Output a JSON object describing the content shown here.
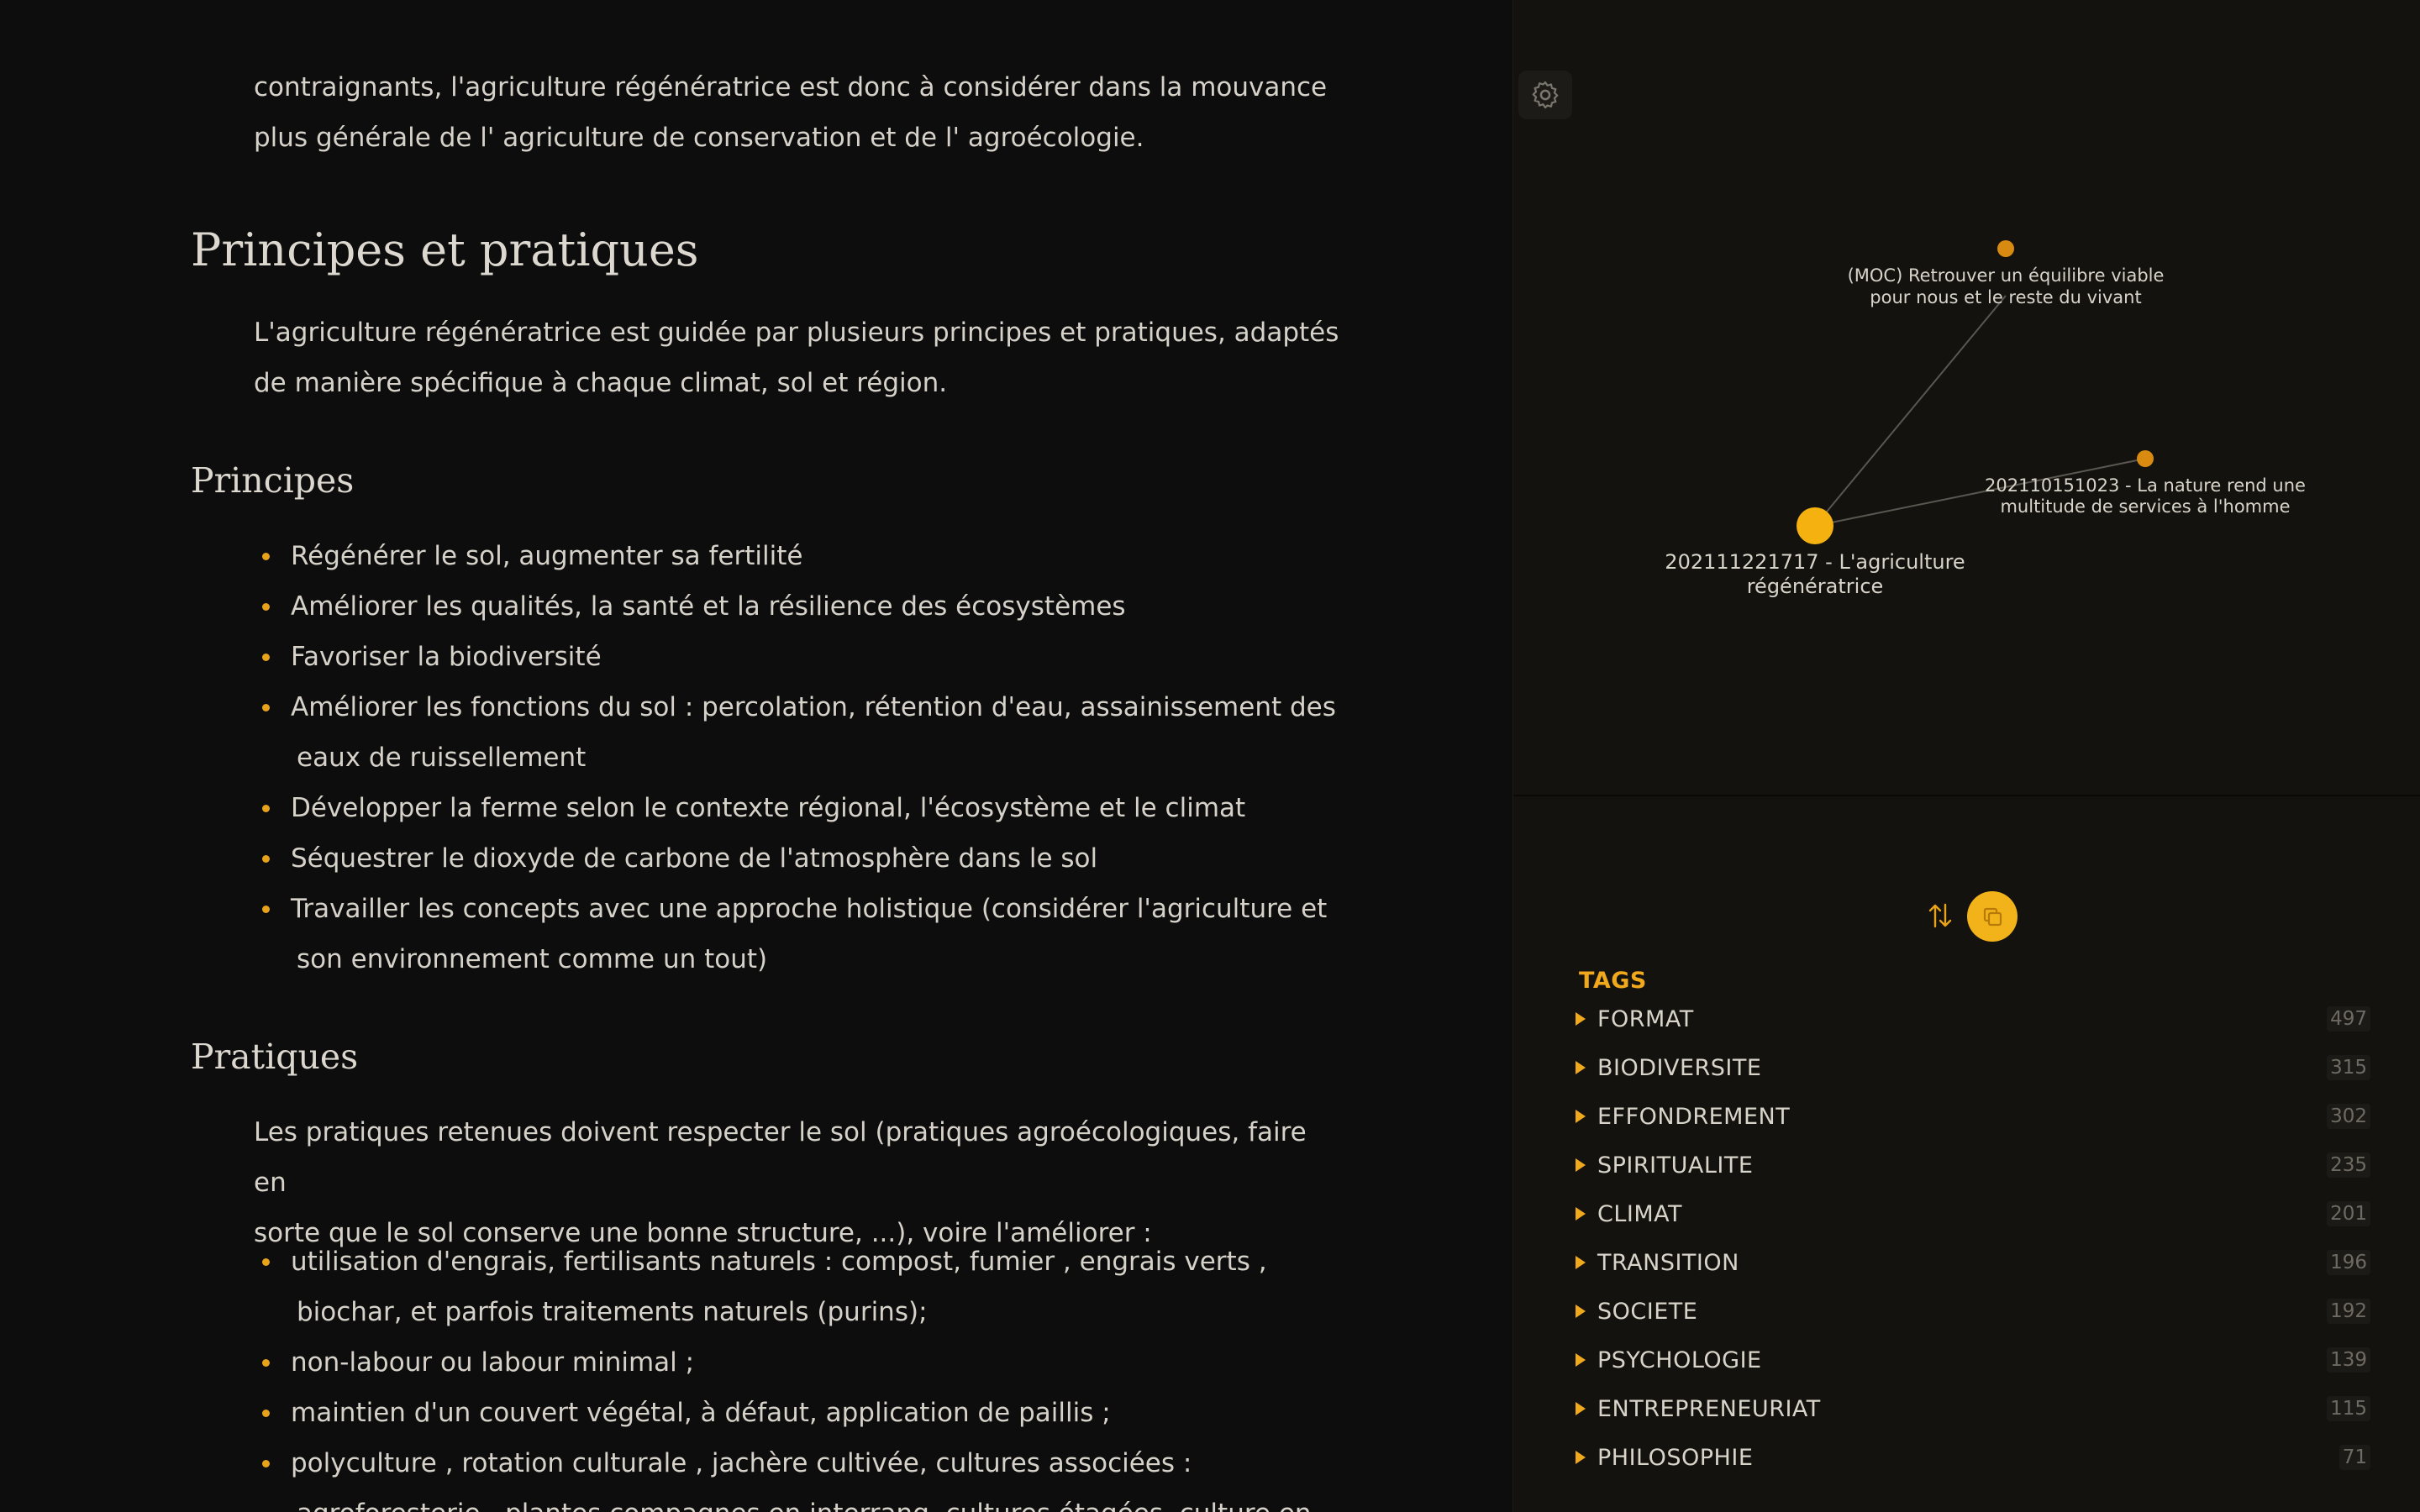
{
  "document": {
    "intro_lines": [
      "contraignants, l'agriculture régénératrice est donc à considérer dans la mouvance",
      "plus générale de l' agriculture de conservation et de l' agroécologie."
    ],
    "h1": "Principes et pratiques",
    "h1_para_lines": [
      "L'agriculture régénératrice est guidée par plusieurs principes et pratiques, adaptés",
      "de manière spécifique à chaque climat, sol et région."
    ],
    "principes": {
      "heading": "Principes",
      "items": [
        {
          "line1": "Régénérer le sol, augmenter sa fertilité",
          "line2": ""
        },
        {
          "line1": "Améliorer les qualités, la santé et la résilience des écosystèmes",
          "line2": ""
        },
        {
          "line1": "Favoriser la biodiversité",
          "line2": ""
        },
        {
          "line1": "Améliorer les fonctions du sol : percolation, rétention d'eau, assainissement des",
          "line2": "eaux de ruissellement"
        },
        {
          "line1": "Développer la ferme selon le contexte régional, l'écosystème et le climat",
          "line2": ""
        },
        {
          "line1": "Séquestrer le dioxyde de carbone de l'atmosphère dans le sol",
          "line2": ""
        },
        {
          "line1": "Travailler les concepts avec une approche holistique (considérer l'agriculture et",
          "line2": "son environnement comme un tout)"
        }
      ]
    },
    "pratiques": {
      "heading": "Pratiques",
      "para_lines": [
        "Les pratiques retenues doivent respecter le sol (pratiques agroécologiques, faire en",
        "sorte que le sol conserve une bonne structure, ...), voire l'améliorer :"
      ],
      "items": [
        {
          "line1": "utilisation d'engrais, fertilisants naturels : compost, fumier , engrais verts ,",
          "line2": "biochar, et parfois traitements naturels (purins);"
        },
        {
          "line1": "non-labour ou labour minimal ;",
          "line2": ""
        },
        {
          "line1": "maintien d'un couvert végétal, à défaut, application de paillis ;",
          "line2": ""
        },
        {
          "line1": "polyculture , rotation culturale , jachère cultivée, cultures associées :",
          "line2": "agroforesterie , plantes compagnes en interrang, cultures étagées, culture en"
        }
      ]
    }
  },
  "graph": {
    "settings_icon": "gear-icon",
    "nodes": {
      "current": {
        "label_line1": "202111221717 - L'agriculture",
        "label_line2": "régénératrice"
      },
      "moc": {
        "label_line1": "(MOC) Retrouver un équilibre viable",
        "label_line2": "pour nous et le reste du vivant"
      },
      "nature": {
        "label_line1": "202110151023 - La nature rend une",
        "label_line2": "multitude de services à l'homme"
      }
    },
    "colors": {
      "node": "#f5b110",
      "node_small": "#d98a10",
      "edge": "#5a5650"
    }
  },
  "tag_pane": {
    "sort_icon": "sort-arrows-icon",
    "collapse_icon": "collapse-icon",
    "header": "TAGS",
    "tags": [
      {
        "name": "FORMAT",
        "count": "497"
      },
      {
        "name": "BIODIVERSITE",
        "count": "315"
      },
      {
        "name": "EFFONDREMENT",
        "count": "302"
      },
      {
        "name": "SPIRITUALITE",
        "count": "235"
      },
      {
        "name": "CLIMAT",
        "count": "201"
      },
      {
        "name": "TRANSITION",
        "count": "196"
      },
      {
        "name": "SOCIETE",
        "count": "192"
      },
      {
        "name": "PSYCHOLOGIE",
        "count": "139"
      },
      {
        "name": "ENTREPRENEURIAT",
        "count": "115"
      },
      {
        "name": "PHILOSOPHIE",
        "count": "71"
      }
    ],
    "accent": "#f0a81c"
  }
}
